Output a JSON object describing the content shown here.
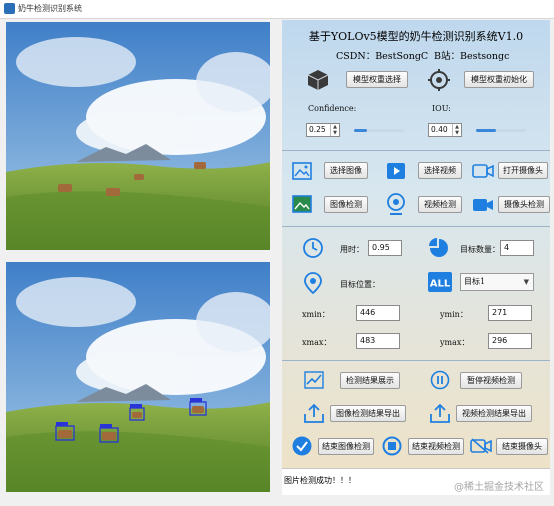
{
  "window": {
    "title": "奶牛检测识别系统"
  },
  "header": {
    "title": "基于YOLOv5模型的奶牛检测识别系统V1.0",
    "csdn": "CSDN：BestSongC",
    "bilibili": "B站：Bestsongc"
  },
  "model": {
    "select_label": "模型权重选择",
    "init_label": "模型权重初始化"
  },
  "params": {
    "confidence_label": "Confidence:",
    "confidence_value": "0.25",
    "confidence_fraction": 0.25,
    "iou_label": "IOU:",
    "iou_value": "0.40",
    "iou_fraction": 0.4
  },
  "sources": {
    "select_image": "选择图像",
    "select_video": "选择视频",
    "open_camera": "打开摄像头",
    "image_detect": "图像检测",
    "video_detect": "视频检测",
    "camera_detect": "摄像头检测"
  },
  "results": {
    "time_label": "用时：",
    "time_value": "0.95",
    "count_label": "目标数量：",
    "count_value": "4",
    "position_label": "目标位置：",
    "target_select": "目标1",
    "xmin_label": "xmin：",
    "xmin_value": "446",
    "ymin_label": "ymin：",
    "ymin_value": "271",
    "xmax_label": "xmax：",
    "xmax_value": "483",
    "ymax_label": "ymax：",
    "ymax_value": "296"
  },
  "actions": {
    "show_results": "检测结果展示",
    "pause_video": "暂停视频检测",
    "export_image": "图像检测结果导出",
    "export_video": "视频检测结果导出",
    "end_image": "结束图像检测",
    "end_video": "结束视频检测",
    "end_camera": "结束摄像头"
  },
  "status": {
    "message": "图片检测成功！！！"
  },
  "watermark": "@稀土掘金技术社区",
  "colors": {
    "accent": "#1e78d0",
    "box": "#2a35d8",
    "icon_blue": "#1f7fe0",
    "icon_dark": "#3a3a3a"
  }
}
